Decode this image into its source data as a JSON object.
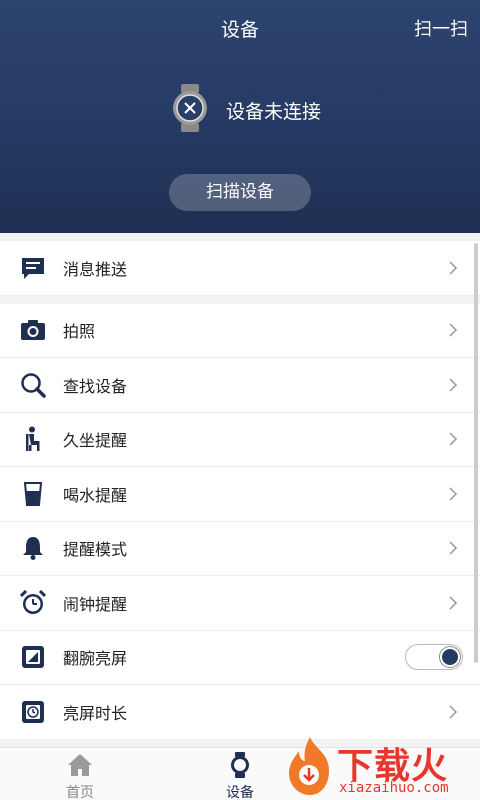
{
  "header": {
    "title": "设备",
    "scan_link": "扫一扫",
    "connection_status": "设备未连接",
    "scan_button": "扫描设备"
  },
  "menu": {
    "message_push": "消息推送",
    "items": [
      {
        "label": "拍照",
        "icon": "camera-icon"
      },
      {
        "label": "查找设备",
        "icon": "search-icon"
      },
      {
        "label": "久坐提醒",
        "icon": "sitting-person-icon"
      },
      {
        "label": "喝水提醒",
        "icon": "water-glass-icon"
      },
      {
        "label": "提醒模式",
        "icon": "bell-icon"
      },
      {
        "label": "闹钟提醒",
        "icon": "alarm-clock-icon"
      },
      {
        "label": "翻腕亮屏",
        "icon": "wrist-screen-icon",
        "toggle_on": true
      },
      {
        "label": "亮屏时长",
        "icon": "screen-timer-icon"
      }
    ]
  },
  "nav": {
    "home": "首页",
    "device": "设备",
    "active_color": "#1e2f52",
    "inactive_color": "#888888"
  },
  "watermark": {
    "title": "下载火",
    "sub": "xiazaihuo.com"
  }
}
